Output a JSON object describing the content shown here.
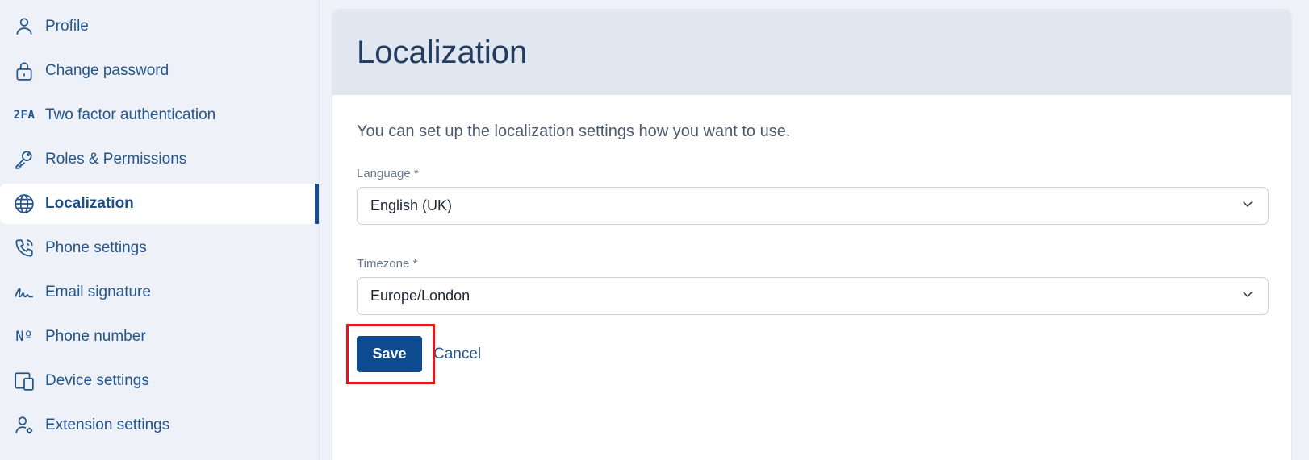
{
  "sidebar": {
    "items": [
      {
        "label": "Profile",
        "icon": "person-icon"
      },
      {
        "label": "Change password",
        "icon": "lock-icon"
      },
      {
        "label": "Two factor authentication",
        "icon": "2fa-icon",
        "icon_text": "2FA"
      },
      {
        "label": "Roles & Permissions",
        "icon": "key-icon"
      },
      {
        "label": "Localization",
        "icon": "globe-icon",
        "active": true
      },
      {
        "label": "Phone settings",
        "icon": "phone-icon"
      },
      {
        "label": "Email signature",
        "icon": "signature-icon"
      },
      {
        "label": "Phone number",
        "icon": "numero-icon",
        "icon_text": "Nº"
      },
      {
        "label": "Device settings",
        "icon": "devices-icon"
      },
      {
        "label": "Extension settings",
        "icon": "user-settings-icon"
      }
    ]
  },
  "main": {
    "title": "Localization",
    "intro": "You can set up the localization settings how you want to use.",
    "language": {
      "label": "Language *",
      "value": "English (UK)"
    },
    "timezone": {
      "label": "Timezone *",
      "value": "Europe/London"
    },
    "save_label": "Save",
    "cancel_label": "Cancel"
  },
  "colors": {
    "accent": "#0d4a8f",
    "highlight": "#e8121c",
    "sidebar_text": "#24568e"
  }
}
